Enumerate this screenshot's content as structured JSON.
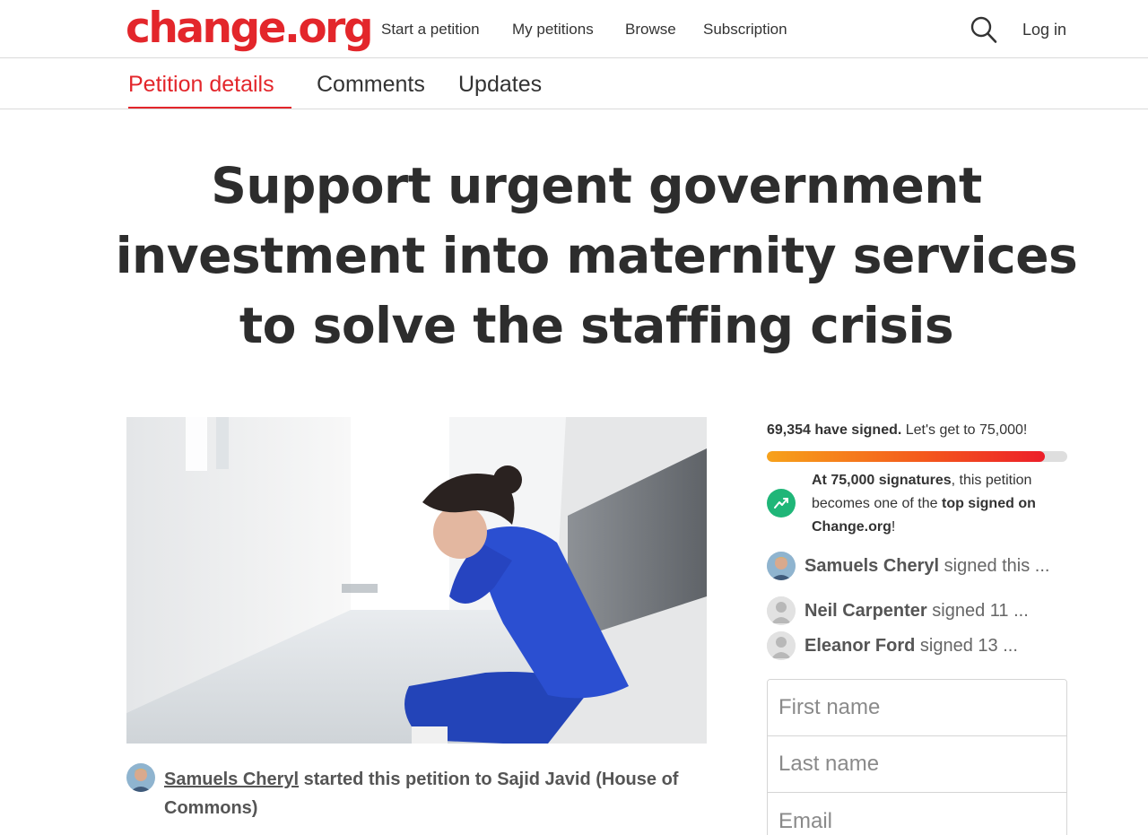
{
  "brand": {
    "logo_text": "change.org",
    "accent_color": "#e3262b"
  },
  "nav": {
    "links": [
      "Start a petition",
      "My petitions",
      "Browse",
      "Subscription"
    ],
    "search_icon": "search-icon",
    "login_label": "Log in"
  },
  "tabs": {
    "items": [
      "Petition details",
      "Comments",
      "Updates"
    ],
    "active": "Petition details"
  },
  "petition": {
    "title": "Support urgent government investment into maternity services to solve the staffing crisis",
    "photo_alt": "",
    "starter_name": "Samuels Cheryl",
    "starter_rest": " started this petition to Sajid Javid (House of Commons)"
  },
  "signatures": {
    "count": "69,354 have signed.",
    "goal_text": " Let's get to 75,000!",
    "progress_fraction": 0.9248,
    "milestone_bold": "At 75,000 signatures",
    "milestone_mid": ", this petition becomes one of the ",
    "milestone_bold2": "top signed on Change.org",
    "milestone_end": "!",
    "trend_icon": "trending-up-icon",
    "trend_color": "#1fb678"
  },
  "recent_signers": [
    {
      "name": "Samuels Cheryl",
      "rest": " signed this ..."
    },
    {
      "name": "Neil Carpenter",
      "rest": " signed 11 ..."
    },
    {
      "name": "Eleanor Ford",
      "rest": " signed 13 ..."
    }
  ],
  "form": {
    "first_name_placeholder": "First name",
    "last_name_placeholder": "Last name",
    "email_placeholder": "Email"
  }
}
